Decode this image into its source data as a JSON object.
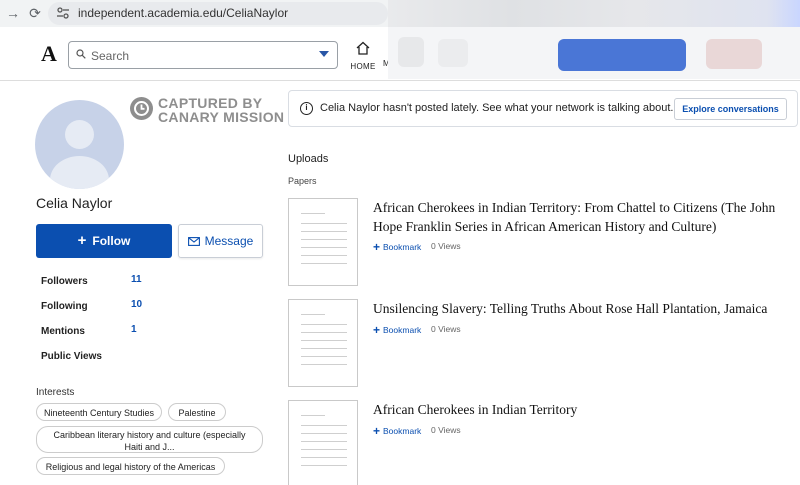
{
  "browser": {
    "url": "independent.academia.edu/CeliaNaylor"
  },
  "header": {
    "logo": "A",
    "search_placeholder": "Search",
    "home_label": "HOME",
    "next_label": "M"
  },
  "watermark": {
    "line1": "CAPTURED BY",
    "line2": "CANARY MISSION"
  },
  "profile": {
    "name": "Celia Naylor",
    "follow_label": "Follow",
    "message_label": "Message",
    "stats": [
      {
        "label": "Followers",
        "value": "11"
      },
      {
        "label": "Following",
        "value": "10"
      },
      {
        "label": "Mentions",
        "value": "1"
      },
      {
        "label": "Public Views",
        "value": ""
      }
    ],
    "interests_heading": "Interests",
    "interests": [
      "Nineteenth Century Studies",
      "Palestine",
      "Caribbean literary history and culture (especially Haiti and J...",
      "Religious and legal history of the Americas"
    ]
  },
  "notice": {
    "message": "Celia Naylor hasn't posted lately. See what your network is talking about.",
    "button": "Explore conversations"
  },
  "uploads": {
    "heading": "Uploads",
    "subheading": "Papers",
    "papers": [
      {
        "title": "African Cherokees in Indian Territory: From Chattel to Citizens (The John Hope Franklin Series in African American History and Culture)",
        "bookmark": "Bookmark",
        "views": "0 Views"
      },
      {
        "title": "Unsilencing Slavery: Telling Truths About Rose Hall Plantation, Jamaica",
        "bookmark": "Bookmark",
        "views": "0 Views"
      },
      {
        "title": "African Cherokees in Indian Territory",
        "bookmark": "Bookmark",
        "views": "0 Views"
      }
    ]
  },
  "colors": {
    "accent": "#0b4fb0",
    "watermark": "#8e8e8e"
  }
}
